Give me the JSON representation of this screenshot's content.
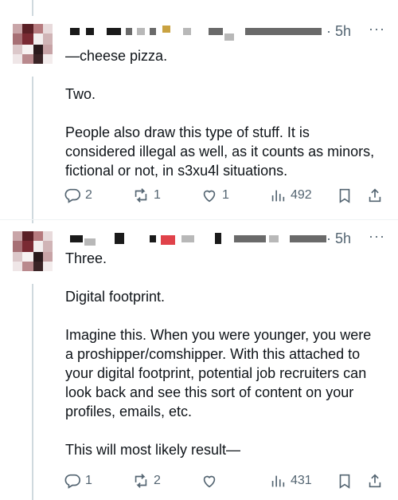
{
  "posts": [
    {
      "time": "· 5h",
      "more": "···",
      "text": "—cheese pizza.\n\nTwo.\n\nPeople also draw this type of stuff. It is considered illegal as well, as it counts as minors, fictional or not, in s3xu4l situations.",
      "replies": "2",
      "reposts": "1",
      "likes": "1",
      "views": "492"
    },
    {
      "time": "· 5h",
      "more": "···",
      "text": "Three.\n\nDigital footprint.\n\nImagine this. When you were younger, you were a proshipper/comshipper. With this attached to your digital footprint, potential job recruiters can look back and see this sort of content on your profiles, emails, etc.\n\nThis will most likely result—",
      "replies": "1",
      "reposts": "2",
      "likes": "",
      "views": "431"
    }
  ],
  "icons": {
    "reply": "reply-icon",
    "repost": "repost-icon",
    "like": "heart-icon",
    "views": "views-icon",
    "bookmark": "bookmark-icon",
    "share": "share-icon"
  },
  "colors": {
    "secondary_text": "#536471",
    "thread_line": "#cfd9de"
  }
}
